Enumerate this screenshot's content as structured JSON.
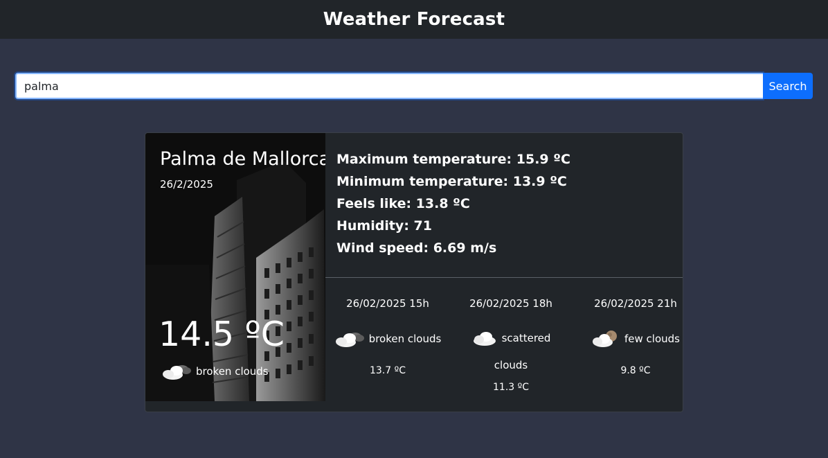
{
  "header": {
    "title": "Weather Forecast"
  },
  "search": {
    "value": "palma",
    "button_label": "Search"
  },
  "current": {
    "city": "Palma de Mallorca",
    "date": "26/2/2025",
    "temperature": "14.5 ºC",
    "description": "broken clouds",
    "icon": "broken-clouds-icon"
  },
  "details": {
    "max_temp": "Maximum temperature: 15.9 ºC",
    "min_temp": "Minimum temperature: 13.9 ºC",
    "feels_like": "Feels like: 13.8 ºC",
    "humidity": "Humidity: 71",
    "wind_speed": "Wind speed: 6.69 m/s"
  },
  "forecast": [
    {
      "time": "26/02/2025 15h",
      "description": "broken clouds",
      "temperature": "13.7 ºC",
      "icon": "broken-clouds-icon"
    },
    {
      "time": "26/02/2025 18h",
      "description_line1": "scattered",
      "description_line2": "clouds",
      "temperature": "11.3 ºC",
      "icon": "scattered-clouds-icon"
    },
    {
      "time": "26/02/2025 21h",
      "description": "few clouds",
      "temperature": "9.8 ºC",
      "icon": "few-clouds-night-icon"
    }
  ]
}
